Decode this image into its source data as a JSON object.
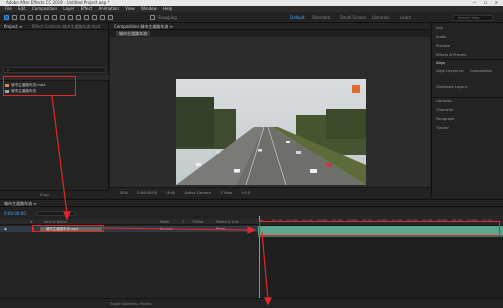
{
  "window": {
    "title": "Adobe After Effects CC 2019 - Untitled Project.aep *",
    "controls": [
      "—",
      "☐",
      "✕"
    ]
  },
  "menu": [
    "File",
    "Edit",
    "Composition",
    "Layer",
    "Effect",
    "Animation",
    "View",
    "Window",
    "Help"
  ],
  "toolbar": {
    "snapping_label": "Snapping",
    "workspaces": [
      "Default",
      "Standard",
      "Small Screen",
      "Libraries",
      "Learn"
    ],
    "active_workspace": "Default",
    "search_placeholder": "Search Help"
  },
  "project_panel": {
    "tabs": [
      "Project ≡",
      "Effect Controls 城市主道路车流.mp4"
    ],
    "search_placeholder": "ρ.",
    "items": [
      {
        "name": "城市主道路车流.mp4",
        "icon": "video-file-icon",
        "color": "#d28c5a"
      },
      {
        "name": "城市主道路车流",
        "icon": "composition-icon",
        "color": "#9aa6b8"
      }
    ],
    "footer": "8 bpc"
  },
  "composition_panel": {
    "tab": "Composition 城市主道路车流 ≡",
    "subtab": "城市主道路车流",
    "controls": [
      "50%",
      "0:00:00:00",
      "(Full)",
      "Active Camera",
      "1 View",
      "+0.0"
    ]
  },
  "right_panel": {
    "items": [
      "Info",
      "Audio",
      "Preview",
      "Effects & Presets",
      "Align",
      "Align Layers to:",
      "Composition",
      "Distribute Layers:",
      "Libraries",
      "Character",
      "Paragraph",
      "Tracker"
    ]
  },
  "timeline": {
    "tab": "城市主道路车流 ≡",
    "current_time": "0:00:00:00",
    "columns": [
      "#",
      "Source Name",
      "Mode",
      "T",
      "TrkMat",
      "Parent & Link"
    ],
    "layer": {
      "index": "1",
      "name": "城市主道路车流.mp4",
      "mode": "Normal",
      "parent": "None"
    },
    "ruler_ticks": [
      "0s",
      "00:15f",
      "01:00f",
      "01:15f",
      "02:00f",
      "02:15f",
      "03:00f",
      "03:15f",
      "04:00f",
      "04:15f",
      "05:00f",
      "05:15f",
      "06:00f",
      "06:15f",
      "07:00f",
      "07:15f"
    ],
    "footer_label": "Toggle Switches / Modes"
  },
  "colors": {
    "accent_blue": "#4ea7ff",
    "annotation_red": "#e0282a",
    "layer_bar": "#5ea58e"
  }
}
